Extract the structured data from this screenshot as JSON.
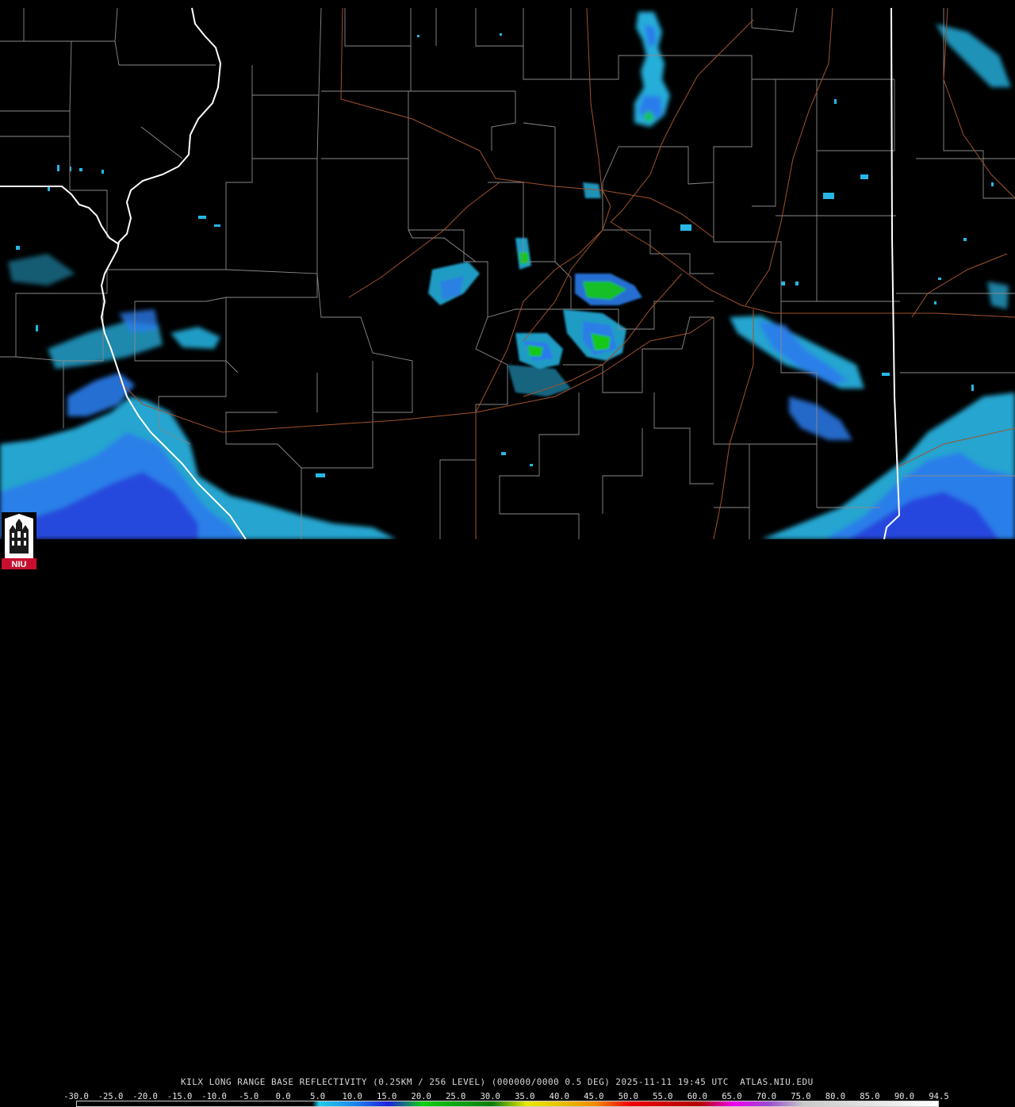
{
  "caption": {
    "text": "KILX LONG RANGE BASE REFLECTIVITY (0.25KM / 256 LEVEL) (000000/0000 0.5 DEG) 2025-11-11 19:45 UTC  ATLAS.NIU.EDU"
  },
  "colorbar": {
    "ticks": [
      "-30.0",
      "-25.0",
      "-20.0",
      "-15.0",
      "-10.0",
      "-5.0",
      "0.0",
      "5.0",
      "10.0",
      "15.0",
      "20.0",
      "25.0",
      "30.0",
      "35.0",
      "40.0",
      "45.0",
      "50.0",
      "55.0",
      "60.0",
      "65.0",
      "70.0",
      "75.0",
      "80.0",
      "85.0",
      "90.0",
      "94.5"
    ],
    "range": [
      -30.0,
      94.5
    ],
    "colors": [
      {
        "value": -30,
        "color": "#000000"
      },
      {
        "value": 4,
        "color": "#000000"
      },
      {
        "value": 5,
        "color": "#1ecde6"
      },
      {
        "value": 10,
        "color": "#1e88ee"
      },
      {
        "value": 15,
        "color": "#1c1fe0"
      },
      {
        "value": 20,
        "color": "#10d010"
      },
      {
        "value": 25,
        "color": "#0fa20f"
      },
      {
        "value": 30,
        "color": "#0b7d0b"
      },
      {
        "value": 35,
        "color": "#e8e800"
      },
      {
        "value": 40,
        "color": "#e8c000"
      },
      {
        "value": 45,
        "color": "#f08a00"
      },
      {
        "value": 50,
        "color": "#f00000"
      },
      {
        "value": 55,
        "color": "#d00000"
      },
      {
        "value": 60,
        "color": "#b40000"
      },
      {
        "value": 65,
        "color": "#f000f0"
      },
      {
        "value": 70,
        "color": "#9a4ad0"
      },
      {
        "value": 75,
        "color": "#c8c8c8"
      },
      {
        "value": 94.5,
        "color": "#ffffff"
      }
    ]
  },
  "logo": {
    "text": "NIU",
    "colors": {
      "background": "#ffffff",
      "band": "#c8102e",
      "tower": "#1a1a1a"
    }
  },
  "map": {
    "background": "#000000",
    "colors": {
      "county": "#8a8a8a",
      "state": "#ffffff",
      "highway": "#a0522d",
      "echo_light": "#27b7e6",
      "echo_mid": "#2a7bea",
      "echo_heavy": "#14c814"
    }
  }
}
